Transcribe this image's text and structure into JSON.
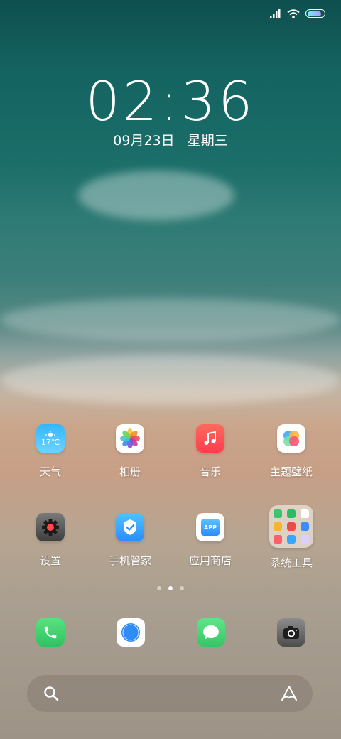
{
  "status_bar": {
    "signal_icon": "signal-bars-icon",
    "wifi_icon": "wifi-icon",
    "battery_icon": "battery-icon",
    "battery_level": 0.85
  },
  "lockclock": {
    "time": "02:36",
    "date": "09月23日",
    "weekday": "星期三"
  },
  "apps": [
    {
      "label": "天气",
      "icon": "weather-icon",
      "temp": "17℃"
    },
    {
      "label": "相册",
      "icon": "photos-icon"
    },
    {
      "label": "音乐",
      "icon": "music-icon"
    },
    {
      "label": "主题壁纸",
      "icon": "theme-wallpaper-icon"
    },
    {
      "label": "设置",
      "icon": "settings-gear-icon"
    },
    {
      "label": "手机管家",
      "icon": "shield-icon"
    },
    {
      "label": "应用商店",
      "icon": "app-store-icon",
      "badge": "APP"
    },
    {
      "label": "系统工具",
      "icon": "folder-icon"
    }
  ],
  "page_indicator": {
    "count": 3,
    "active": 2
  },
  "dock": [
    {
      "icon": "phone-icon"
    },
    {
      "icon": "safari-compass-icon"
    },
    {
      "icon": "messages-icon"
    },
    {
      "icon": "camera-icon"
    }
  ],
  "search_bar": {
    "left_icon": "search-icon",
    "right_icon": "assistant-icon"
  },
  "colors": {
    "sea": "#146461",
    "sand": "#c79f86",
    "accent_blue": "#33b6ff",
    "music_red": "#ff3d4f",
    "green": "#33c766"
  }
}
